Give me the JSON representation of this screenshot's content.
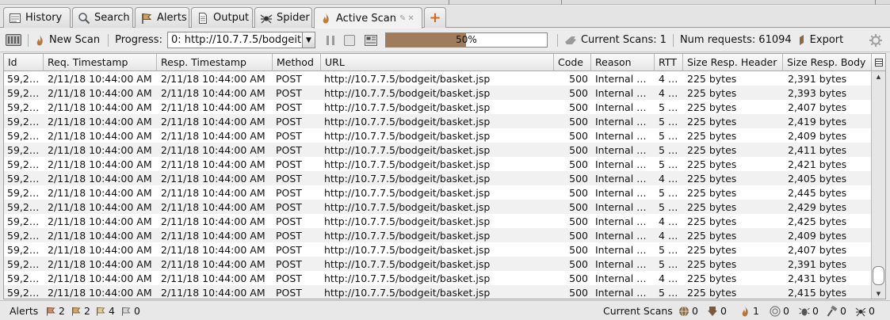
{
  "tabs": [
    {
      "label": "History",
      "icon": "history-icon"
    },
    {
      "label": "Search",
      "icon": "search-icon"
    },
    {
      "label": "Alerts",
      "icon": "flag-icon"
    },
    {
      "label": "Output",
      "icon": "document-icon"
    },
    {
      "label": "Spider",
      "icon": "spider-icon"
    },
    {
      "label": "Active Scan",
      "icon": "flame-icon",
      "active": true
    }
  ],
  "toolbar": {
    "new_scan_label": "New Scan",
    "progress_label": "Progress:",
    "scan_select_value": "0: http://10.7.7.5/bodgeit",
    "progress_percent_text": "50%",
    "progress_fraction": 0.5,
    "current_scans_label": "Current Scans:",
    "current_scans_value": "1",
    "num_requests_label": "Num requests:",
    "num_requests_value": "61094",
    "export_label": "Export"
  },
  "table": {
    "columns": [
      "Id",
      "Req. Timestamp",
      "Resp. Timestamp",
      "Method",
      "URL",
      "Code",
      "Reason",
      "RTT",
      "Size Resp. Header",
      "Size Resp. Body"
    ],
    "rows": [
      [
        "59,2…",
        "2/11/18 10:44:00 AM",
        "2/11/18 10:44:00 AM",
        "POST",
        "http://10.7.7.5/bodgeit/basket.jsp",
        "500",
        "Internal …",
        "4 …",
        "225 bytes",
        "2,391 bytes"
      ],
      [
        "59,2…",
        "2/11/18 10:44:00 AM",
        "2/11/18 10:44:00 AM",
        "POST",
        "http://10.7.7.5/bodgeit/basket.jsp",
        "500",
        "Internal …",
        "4 …",
        "225 bytes",
        "2,393 bytes"
      ],
      [
        "59,2…",
        "2/11/18 10:44:00 AM",
        "2/11/18 10:44:00 AM",
        "POST",
        "http://10.7.7.5/bodgeit/basket.jsp",
        "500",
        "Internal …",
        "5 …",
        "225 bytes",
        "2,407 bytes"
      ],
      [
        "59,2…",
        "2/11/18 10:44:00 AM",
        "2/11/18 10:44:00 AM",
        "POST",
        "http://10.7.7.5/bodgeit/basket.jsp",
        "500",
        "Internal …",
        "5 …",
        "225 bytes",
        "2,419 bytes"
      ],
      [
        "59,2…",
        "2/11/18 10:44:00 AM",
        "2/11/18 10:44:00 AM",
        "POST",
        "http://10.7.7.5/bodgeit/basket.jsp",
        "500",
        "Internal …",
        "5 …",
        "225 bytes",
        "2,409 bytes"
      ],
      [
        "59,2…",
        "2/11/18 10:44:00 AM",
        "2/11/18 10:44:00 AM",
        "POST",
        "http://10.7.7.5/bodgeit/basket.jsp",
        "500",
        "Internal …",
        "5 …",
        "225 bytes",
        "2,411 bytes"
      ],
      [
        "59,2…",
        "2/11/18 10:44:00 AM",
        "2/11/18 10:44:00 AM",
        "POST",
        "http://10.7.7.5/bodgeit/basket.jsp",
        "500",
        "Internal …",
        "5 …",
        "225 bytes",
        "2,421 bytes"
      ],
      [
        "59,2…",
        "2/11/18 10:44:00 AM",
        "2/11/18 10:44:00 AM",
        "POST",
        "http://10.7.7.5/bodgeit/basket.jsp",
        "500",
        "Internal …",
        "4 …",
        "225 bytes",
        "2,405 bytes"
      ],
      [
        "59,2…",
        "2/11/18 10:44:00 AM",
        "2/11/18 10:44:00 AM",
        "POST",
        "http://10.7.7.5/bodgeit/basket.jsp",
        "500",
        "Internal …",
        "5 …",
        "225 bytes",
        "2,445 bytes"
      ],
      [
        "59,2…",
        "2/11/18 10:44:00 AM",
        "2/11/18 10:44:00 AM",
        "POST",
        "http://10.7.7.5/bodgeit/basket.jsp",
        "500",
        "Internal …",
        "5 …",
        "225 bytes",
        "2,429 bytes"
      ],
      [
        "59,2…",
        "2/11/18 10:44:00 AM",
        "2/11/18 10:44:00 AM",
        "POST",
        "http://10.7.7.5/bodgeit/basket.jsp",
        "500",
        "Internal …",
        "4 …",
        "225 bytes",
        "2,425 bytes"
      ],
      [
        "59,2…",
        "2/11/18 10:44:00 AM",
        "2/11/18 10:44:00 AM",
        "POST",
        "http://10.7.7.5/bodgeit/basket.jsp",
        "500",
        "Internal …",
        "4 …",
        "225 bytes",
        "2,409 bytes"
      ],
      [
        "59,2…",
        "2/11/18 10:44:00 AM",
        "2/11/18 10:44:00 AM",
        "POST",
        "http://10.7.7.5/bodgeit/basket.jsp",
        "500",
        "Internal …",
        "5 …",
        "225 bytes",
        "2,407 bytes"
      ],
      [
        "59,2…",
        "2/11/18 10:44:00 AM",
        "2/11/18 10:44:00 AM",
        "POST",
        "http://10.7.7.5/bodgeit/basket.jsp",
        "500",
        "Internal …",
        "5 …",
        "225 bytes",
        "2,391 bytes"
      ],
      [
        "59,2…",
        "2/11/18 10:44:00 AM",
        "2/11/18 10:44:00 AM",
        "POST",
        "http://10.7.7.5/bodgeit/basket.jsp",
        "500",
        "Internal …",
        "4 …",
        "225 bytes",
        "2,431 bytes"
      ],
      [
        "59,2…",
        "2/11/18 10:44:00 AM",
        "2/11/18 10:44:00 AM",
        "POST",
        "http://10.7.7.5/bodgeit/basket.jsp",
        "500",
        "Internal …",
        "5 …",
        "225 bytes",
        "2,415 bytes"
      ]
    ]
  },
  "statusbar": {
    "alerts_label": "Alerts",
    "alert_counts": [
      {
        "icon": "flag-red-icon",
        "value": "2",
        "color": "#b03020"
      },
      {
        "icon": "flag-orange-icon",
        "value": "2",
        "color": "#e08a1e"
      },
      {
        "icon": "flag-yellow-icon",
        "value": "4",
        "color": "#e6c200"
      },
      {
        "icon": "flag-blue-icon",
        "value": "0",
        "color": "#3a6fc0"
      }
    ],
    "current_scans_label": "Current Scans",
    "scan_counts": [
      {
        "icon": "globe-icon",
        "value": "0"
      },
      {
        "icon": "spider-down-icon",
        "value": "0"
      },
      {
        "icon": "flame-icon",
        "value": "1"
      },
      {
        "icon": "target-icon",
        "value": "0"
      },
      {
        "icon": "bug-icon",
        "value": "0"
      },
      {
        "icon": "hammer-icon",
        "value": "0"
      },
      {
        "icon": "spider-icon",
        "value": "0"
      }
    ]
  },
  "colors": {
    "progress_fill": "#a07b5c",
    "accent": "#d2691e"
  }
}
